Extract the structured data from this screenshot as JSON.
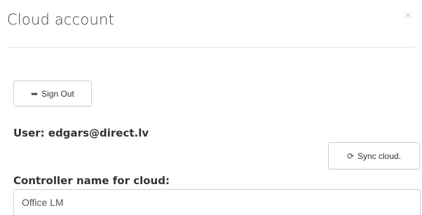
{
  "dialog": {
    "title": "Cloud account",
    "close_symbol": "×"
  },
  "signout": {
    "icon": "sign-out-icon",
    "icon_glyph": "➥",
    "label": "Sign Out"
  },
  "user": {
    "label": "User: edgars@direct.lv"
  },
  "sync": {
    "icon": "refresh-icon",
    "icon_glyph": "⟳",
    "label": "Sync cloud."
  },
  "controller": {
    "label": "Controller name for cloud:",
    "value": "Office LM"
  }
}
